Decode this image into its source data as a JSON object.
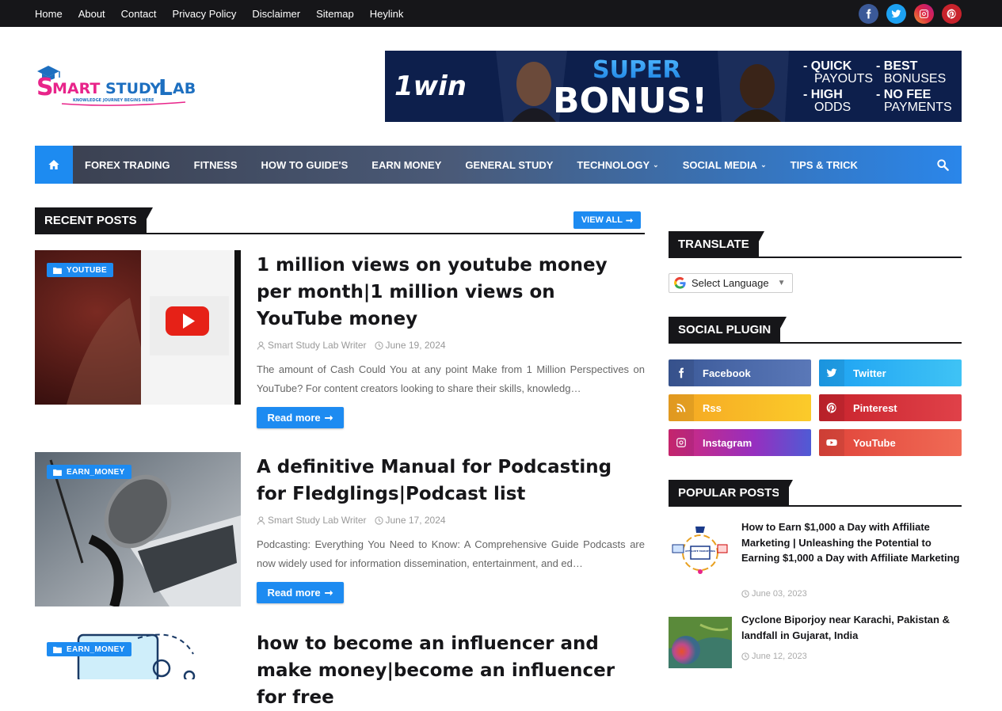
{
  "topnav": [
    "Home",
    "About",
    "Contact",
    "Privacy Policy",
    "Disclaimer",
    "Sitemap",
    "Heylink"
  ],
  "top_social": [
    {
      "name": "facebook",
      "color": "#3b5998"
    },
    {
      "name": "twitter",
      "color": "#1da1f2"
    },
    {
      "name": "instagram",
      "color": "#c13584"
    },
    {
      "name": "pinterest",
      "color": "#c8232c"
    }
  ],
  "logo": {
    "text_s": "S",
    "text_mart": "MART ",
    "text_study": "STUDY ",
    "text_l": "L",
    "text_ab": "AB",
    "tagline": "KNOWLEDGE JOURNEY BEGINS HERE"
  },
  "banner": {
    "brand": "1win",
    "line1": "SUPER",
    "line2": "BONUS!",
    "items": [
      "- QUICK",
      "PAYOUTS",
      "- BEST",
      "BONUSES",
      "- HIGH",
      "ODDS",
      "- NO FEE",
      "PAYMENTS"
    ]
  },
  "mainnav": {
    "items": [
      {
        "label": "FOREX TRADING",
        "dropdown": false
      },
      {
        "label": "FITNESS",
        "dropdown": false
      },
      {
        "label": "HOW TO GUIDE'S",
        "dropdown": false
      },
      {
        "label": "EARN MONEY",
        "dropdown": false
      },
      {
        "label": "GENERAL STUDY",
        "dropdown": false
      },
      {
        "label": "TECHNOLOGY",
        "dropdown": true
      },
      {
        "label": "SOCIAL MEDIA",
        "dropdown": true
      },
      {
        "label": "TIPS & TRICK",
        "dropdown": false
      }
    ],
    "chevron": "⌄"
  },
  "recent": {
    "title": "RECENT POSTS",
    "view_all": "VIEW ALL",
    "arrow": "➞"
  },
  "posts": [
    {
      "tag": "YOUTUBE",
      "title": "1 million views on youtube money per month|1 million views on YouTube money",
      "author": "Smart Study Lab Writer",
      "date": "June 19, 2024",
      "excerpt": "The amount of Cash Could You at any point Make from 1 Million Perspectives on YouTube? For content creators looking to share their skills, knowledg…",
      "read_more": "Read more"
    },
    {
      "tag": "EARN_MONEY",
      "title": "A definitive Manual for Podcasting for Fledglings|Podcast list",
      "author": "Smart Study Lab Writer",
      "date": "June 17, 2024",
      "excerpt": "Podcasting: Everything You Need to Know: A Comprehensive Guide Podcasts are now widely used for information dissemination, entertainment, and ed…",
      "read_more": "Read more"
    },
    {
      "tag": "EARN_MONEY",
      "title": "how to become an influencer and make money|become an influencer for free",
      "author": "",
      "date": "",
      "excerpt": "",
      "read_more": ""
    }
  ],
  "sidebar": {
    "translate_title": "TRANSLATE",
    "language_select": "Select Language",
    "social_title": "SOCIAL PLUGIN",
    "social": [
      {
        "label": "Facebook",
        "color": "#3b5998"
      },
      {
        "label": "Twitter",
        "color": "#1da1f2"
      },
      {
        "label": "Rss",
        "color": "#f5b51e"
      },
      {
        "label": "Pinterest",
        "color": "#c8232c"
      },
      {
        "label": "Instagram",
        "color": "#c13584"
      },
      {
        "label": "YouTube",
        "color": "#e14b3a"
      }
    ],
    "popular_title": "POPULAR POSTS",
    "popular": [
      {
        "title": "How to Earn $1,000 a Day with Affiliate Marketing | Unleashing the Potential to Earning $1,000 a Day with Affiliate Marketing",
        "date": "June 03, 2023",
        "image_text": "AFFILIATE MARKETING"
      },
      {
        "title": "Cyclone Biporjoy near Karachi, Pakistan & landfall in Gujarat, India",
        "date": "June 12, 2023"
      }
    ]
  }
}
